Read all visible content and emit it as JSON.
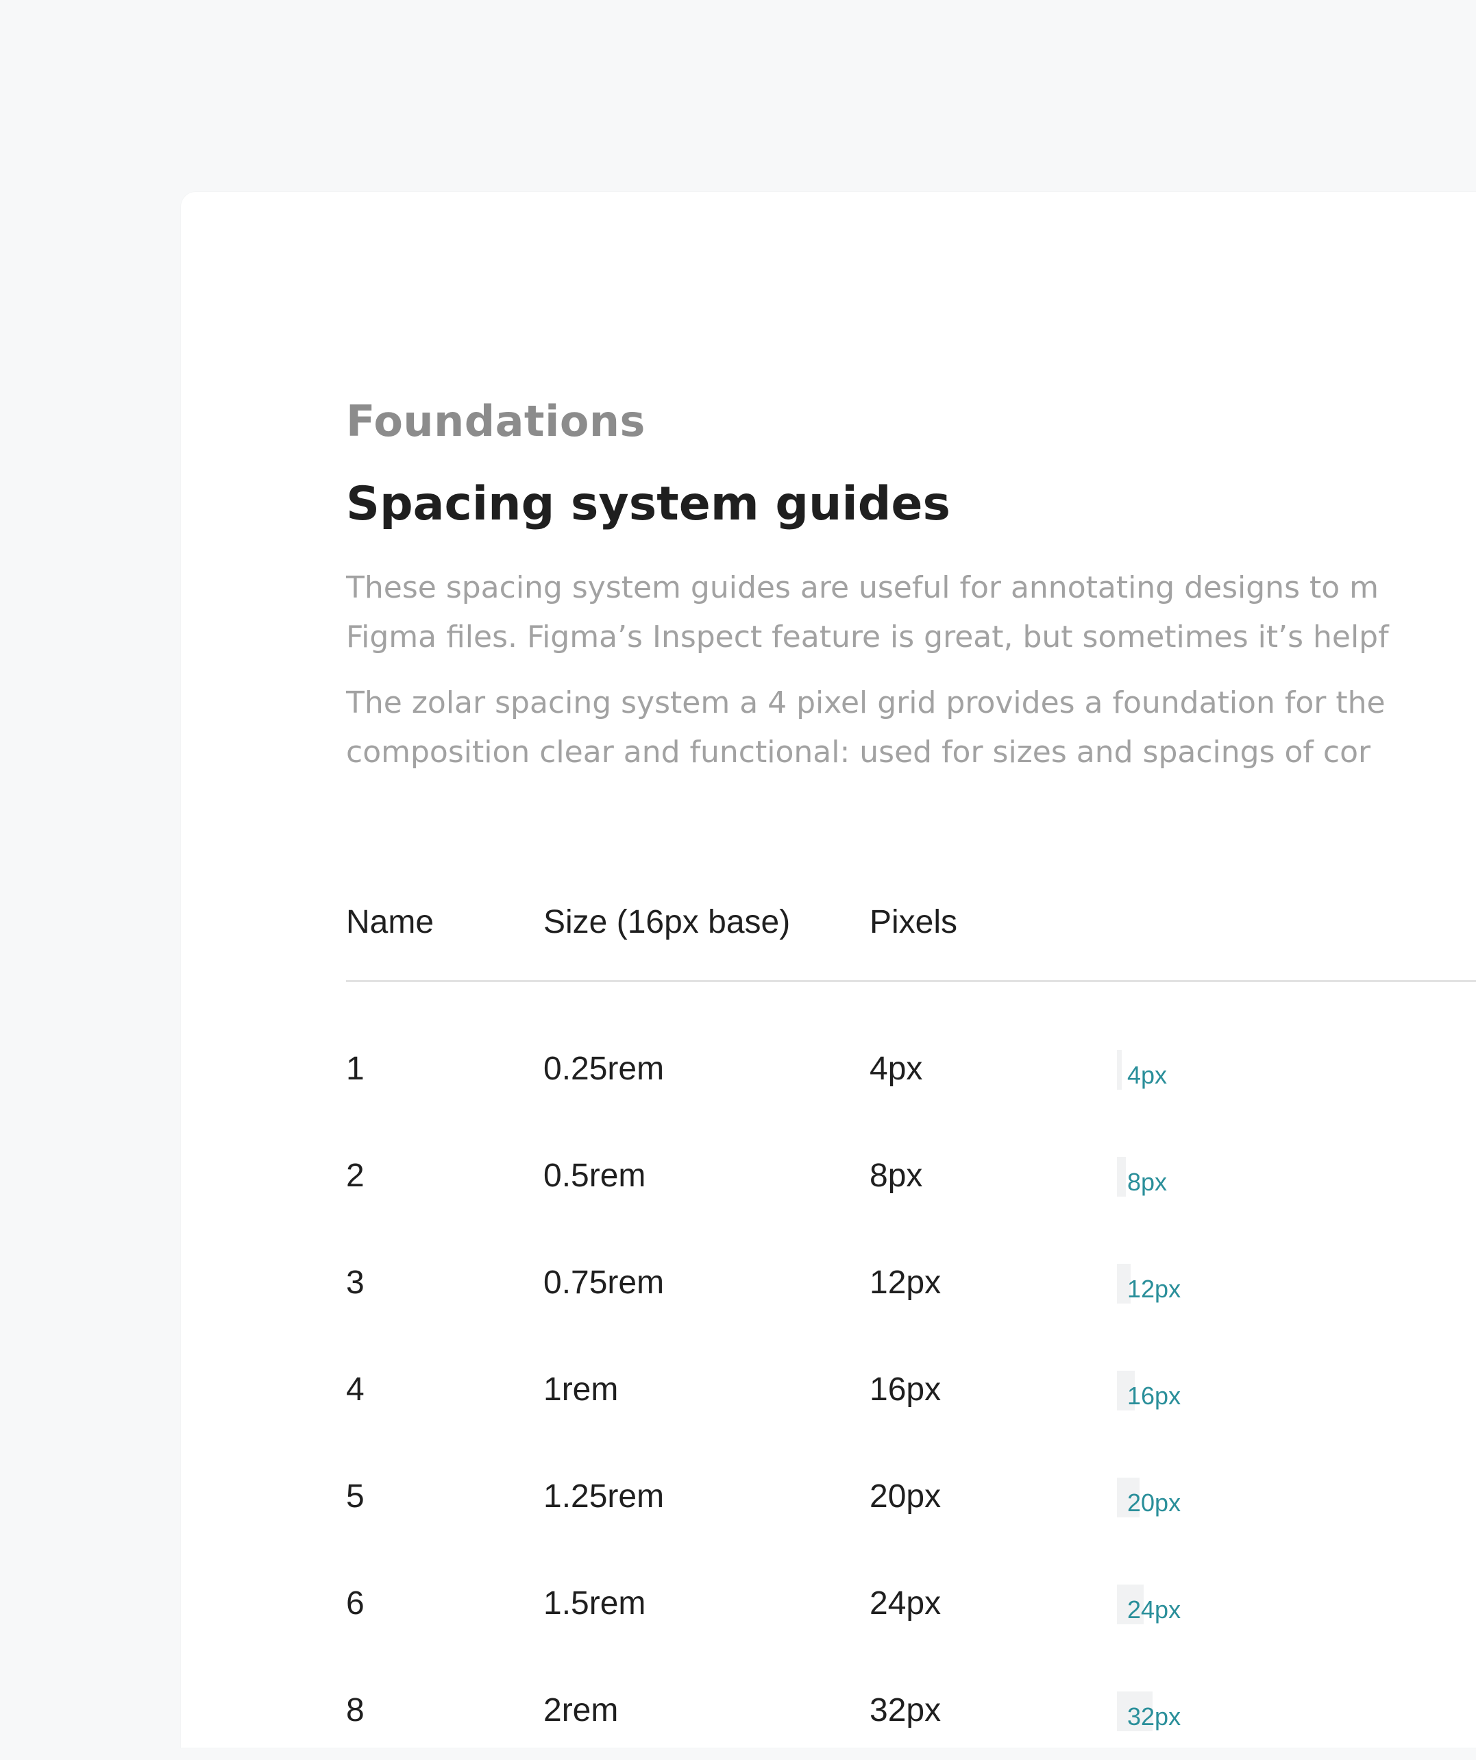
{
  "header": {
    "eyebrow": "Foundations",
    "title": "Spacing system guides"
  },
  "intro": {
    "p1_line1": "These spacing system guides are useful for annotating designs to m",
    "p1_line2": "Figma files. Figma’s Inspect feature is great, but sometimes it’s helpf",
    "p2_line1": "The zolar spacing system a 4 pixel grid provides a foundation for the",
    "p2_line2": "composition clear and functional: used for sizes and spacings of cor"
  },
  "table": {
    "headers": {
      "name": "Name",
      "size": "Size (16px base)",
      "pixels": "Pixels"
    },
    "rows": [
      {
        "name": "1",
        "size": "0.25rem",
        "pixels": "4px",
        "swatch": "4px",
        "value": 4
      },
      {
        "name": "2",
        "size": "0.5rem",
        "pixels": "8px",
        "swatch": "8px",
        "value": 8
      },
      {
        "name": "3",
        "size": "0.75rem",
        "pixels": "12px",
        "swatch": "12px",
        "value": 12
      },
      {
        "name": "4",
        "size": "1rem",
        "pixels": "16px",
        "swatch": "16px",
        "value": 16
      },
      {
        "name": "5",
        "size": "1.25rem",
        "pixels": "20px",
        "swatch": "20px",
        "value": 20
      },
      {
        "name": "6",
        "size": "1.5rem",
        "pixels": "24px",
        "swatch": "24px",
        "value": 24
      },
      {
        "name": "8",
        "size": "2rem",
        "pixels": "32px",
        "swatch": "32px",
        "value": 32
      }
    ]
  },
  "colors": {
    "background": "#f7f8f9",
    "card": "#ffffff",
    "eyebrow": "#8c8c8c",
    "title": "#1f1f1f",
    "body_text": "#a2a2a2",
    "swatch_bg": "#f1f2f3",
    "swatch_text": "#2a8f9a",
    "divider": "#e2e2e2"
  }
}
